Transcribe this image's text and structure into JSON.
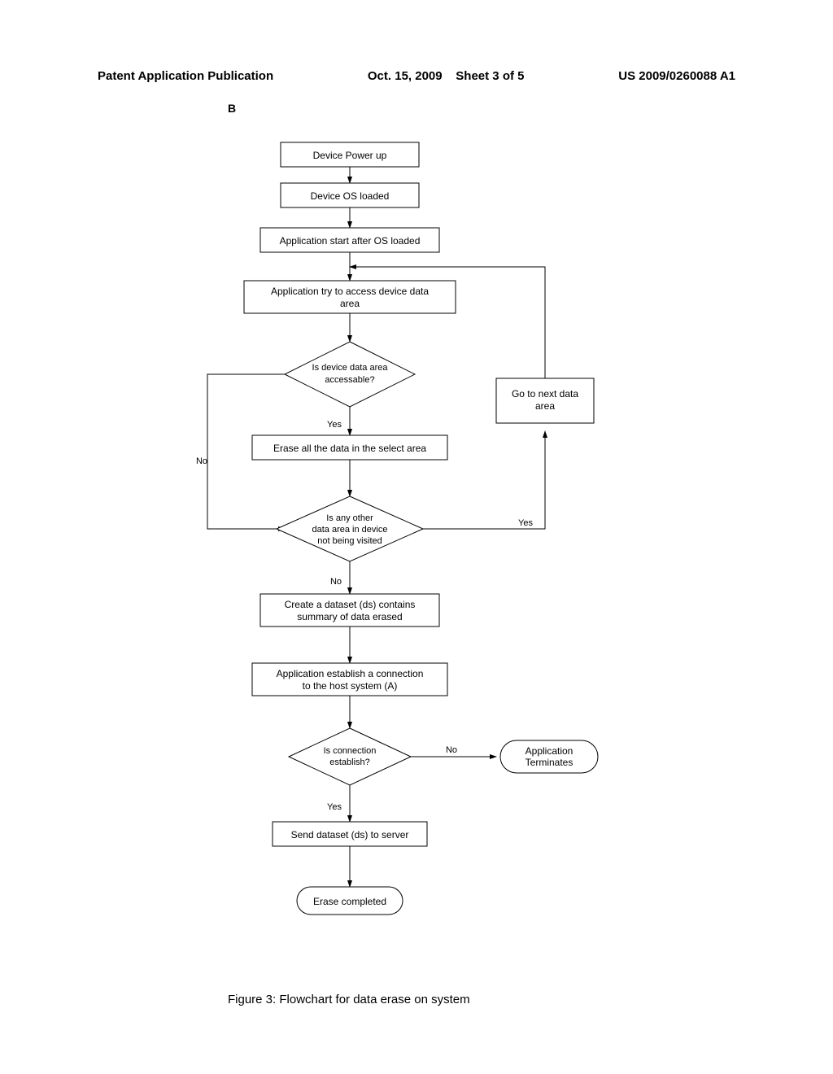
{
  "header": {
    "publication_label": "Patent Application Publication",
    "date": "Oct. 15, 2009",
    "sheet": "Sheet 3 of 5",
    "pub_number": "US 2009/0260088 A1"
  },
  "section_label": "B",
  "caption": "Figure 3:  Flowchart for data erase on system",
  "chart_data": {
    "type": "flowchart",
    "nodes": [
      {
        "id": "n1",
        "type": "process",
        "text": "Device Power up"
      },
      {
        "id": "n2",
        "type": "process",
        "text": "Device OS loaded"
      },
      {
        "id": "n3",
        "type": "process",
        "text": "Application start after OS loaded"
      },
      {
        "id": "n4",
        "type": "process",
        "text": "Application try to access device data area"
      },
      {
        "id": "d1",
        "type": "decision",
        "text": "Is device data area accessable?"
      },
      {
        "id": "n5",
        "type": "process",
        "text": "Erase all the data in the select area"
      },
      {
        "id": "d2",
        "type": "decision",
        "text": "Is any other data area in device not being visited"
      },
      {
        "id": "n6",
        "type": "process",
        "text": "Create a dataset (ds) contains summary of data erased"
      },
      {
        "id": "n7",
        "type": "process",
        "text": "Application establish a connection to the host system (A)"
      },
      {
        "id": "d3",
        "type": "decision",
        "text": "Is connection establish?"
      },
      {
        "id": "n8",
        "type": "process",
        "text": "Send dataset (ds) to server"
      },
      {
        "id": "t1",
        "type": "terminator",
        "text": "Application Terminates"
      },
      {
        "id": "t2",
        "type": "terminator",
        "text": "Erase completed"
      },
      {
        "id": "g1",
        "type": "process",
        "text": "Go to next data area"
      }
    ],
    "edges": [
      {
        "from": "n1",
        "to": "n2"
      },
      {
        "from": "n2",
        "to": "n3"
      },
      {
        "from": "n3",
        "to": "n4"
      },
      {
        "from": "n4",
        "to": "d1"
      },
      {
        "from": "d1",
        "to": "n5",
        "label": "Yes"
      },
      {
        "from": "d1",
        "to": "d2",
        "label": "No",
        "path": "left-down"
      },
      {
        "from": "n5",
        "to": "d2"
      },
      {
        "from": "d2",
        "to": "n6",
        "label": "No"
      },
      {
        "from": "d2",
        "to": "g1",
        "label": "Yes"
      },
      {
        "from": "g1",
        "to": "n4",
        "path": "up-left"
      },
      {
        "from": "n6",
        "to": "n7"
      },
      {
        "from": "n7",
        "to": "d3"
      },
      {
        "from": "d3",
        "to": "n8",
        "label": "Yes"
      },
      {
        "from": "d3",
        "to": "t1",
        "label": "No"
      },
      {
        "from": "n8",
        "to": "t2"
      }
    ]
  }
}
